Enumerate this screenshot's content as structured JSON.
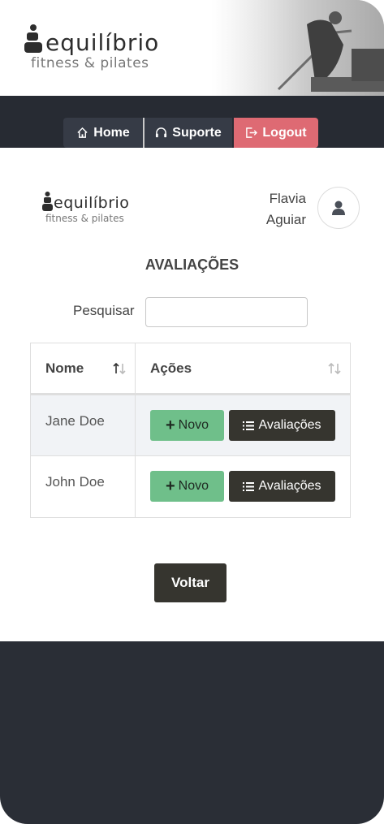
{
  "brand": {
    "name": "equilíbrio",
    "tagline": "fitness & pilates"
  },
  "nav": {
    "home": "Home",
    "suporte": "Suporte",
    "logout": "Logout"
  },
  "user": {
    "first_name": "Flavia",
    "last_name": "Aguiar"
  },
  "page": {
    "title": "AVALIAÇÕES"
  },
  "search": {
    "label": "Pesquisar",
    "value": "",
    "placeholder": ""
  },
  "table": {
    "headers": [
      "Nome",
      "Ações"
    ],
    "rows": [
      {
        "name": "Jane Doe",
        "novo_label": "Novo",
        "avaliacoes_label": "Avaliações"
      },
      {
        "name": "John Doe",
        "novo_label": "Novo",
        "avaliacoes_label": "Avaliações"
      }
    ]
  },
  "actions": {
    "voltar": "Voltar"
  },
  "colors": {
    "navbar": "#272b33",
    "logout": "#de6a73",
    "novo": "#6fbf8a",
    "dark_button": "#36352f",
    "footer": "#2a2e36"
  },
  "icons": {
    "home": "home-icon",
    "suporte": "headset-icon",
    "logout": "logout-icon",
    "avatar": "user-icon",
    "sort": "sort-icon",
    "novo": "plus-icon",
    "avaliacoes": "list-icon"
  }
}
